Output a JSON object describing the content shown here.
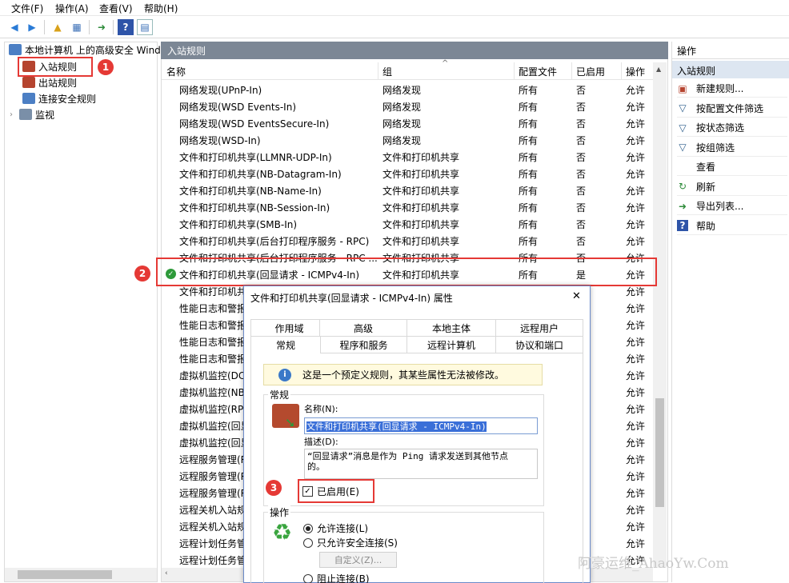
{
  "menu": [
    "文件(F)",
    "操作(A)",
    "查看(V)",
    "帮助(H)"
  ],
  "tree": {
    "root": "本地计算机 上的高级安全 Windows",
    "items": [
      "入站规则",
      "出站规则",
      "连接安全规则",
      "监视"
    ]
  },
  "panel_title": "入站规则",
  "columns": [
    "名称",
    "组",
    "配置文件",
    "已启用",
    "操作"
  ],
  "rows": [
    [
      "网络发现(UPnP-In)",
      "网络发现",
      "所有",
      "否",
      "允许"
    ],
    [
      "网络发现(WSD Events-In)",
      "网络发现",
      "所有",
      "否",
      "允许"
    ],
    [
      "网络发现(WSD EventsSecure-In)",
      "网络发现",
      "所有",
      "否",
      "允许"
    ],
    [
      "网络发现(WSD-In)",
      "网络发现",
      "所有",
      "否",
      "允许"
    ],
    [
      "文件和打印机共享(LLMNR-UDP-In)",
      "文件和打印机共享",
      "所有",
      "否",
      "允许"
    ],
    [
      "文件和打印机共享(NB-Datagram-In)",
      "文件和打印机共享",
      "所有",
      "否",
      "允许"
    ],
    [
      "文件和打印机共享(NB-Name-In)",
      "文件和打印机共享",
      "所有",
      "否",
      "允许"
    ],
    [
      "文件和打印机共享(NB-Session-In)",
      "文件和打印机共享",
      "所有",
      "否",
      "允许"
    ],
    [
      "文件和打印机共享(SMB-In)",
      "文件和打印机共享",
      "所有",
      "否",
      "允许"
    ],
    [
      "文件和打印机共享(后台打印程序服务 - RPC)",
      "文件和打印机共享",
      "所有",
      "否",
      "允许"
    ],
    [
      "文件和打印机共享(后台打印程序服务 - RPC ...",
      "文件和打印机共享",
      "所有",
      "否",
      "允许"
    ],
    [
      "文件和打印机共享(回显请求 - ICMPv4-In)",
      "文件和打印机共享",
      "所有",
      "是",
      "允许"
    ],
    [
      "文件和打印机共",
      "",
      "",
      "",
      "允许"
    ],
    [
      "性能日志和警报",
      "",
      "",
      "",
      "允许"
    ],
    [
      "性能日志和警报",
      "",
      "",
      "",
      "允许"
    ],
    [
      "性能日志和警报",
      "",
      "",
      "",
      "允许"
    ],
    [
      "性能日志和警报",
      "",
      "",
      "",
      "允许"
    ],
    [
      "虚拟机监控(DC",
      "",
      "",
      "",
      "允许"
    ],
    [
      "虚拟机监控(NB",
      "",
      "",
      "",
      "允许"
    ],
    [
      "虚拟机监控(RP",
      "",
      "",
      "",
      "允许"
    ],
    [
      "虚拟机监控(回显",
      "",
      "",
      "",
      "允许"
    ],
    [
      "虚拟机监控(回显",
      "",
      "",
      "",
      "允许"
    ],
    [
      "远程服务管理(R",
      "",
      "",
      "",
      "允许"
    ],
    [
      "远程服务管理(R",
      "",
      "",
      "",
      "允许"
    ],
    [
      "远程服务管理(R",
      "",
      "",
      "",
      "允许"
    ],
    [
      "远程关机入站规",
      "",
      "",
      "",
      "允许"
    ],
    [
      "远程关机入站规",
      "",
      "",
      "",
      "允许"
    ],
    [
      "远程计划任务管",
      "",
      "",
      "",
      "允许"
    ],
    [
      "远程计划任务管",
      "",
      "",
      "",
      "允许"
    ]
  ],
  "actions": {
    "title": "操作",
    "section": "入站规则",
    "items": [
      "新建规则...",
      "按配置文件筛选",
      "按状态筛选",
      "按组筛选",
      "查看",
      "刷新",
      "导出列表...",
      "帮助"
    ]
  },
  "badges": [
    "1",
    "2",
    "3"
  ],
  "dialog": {
    "title": "文件和打印机共享(回显请求 - ICMPv4-In) 属性",
    "close": "✕",
    "tabs_row1": [
      "作用域",
      "高级",
      "本地主体",
      "远程用户"
    ],
    "tabs_row2": [
      "常规",
      "程序和服务",
      "远程计算机",
      "协议和端口"
    ],
    "info": "这是一个预定义规则，其某些属性无法被修改。",
    "general_label": "常规",
    "name_label": "名称(N):",
    "name_value": "文件和打印机共享(回显请求 - ICMPv4-In)",
    "desc_label": "描述(D):",
    "desc_value": "“回显请求”消息是作为 Ping 请求发送到其他节点的。",
    "enabled_label": "已启用(E)",
    "action_label": "操作",
    "radio_allow": "允许连接(L)",
    "radio_secure": "只允许安全连接(S)",
    "customize": "自定义(Z)...",
    "radio_block": "阻止连接(B)"
  },
  "watermark": "阿豪运维_AhaoYw.Com",
  "colors": {
    "accent": "#7c8795",
    "highlight_red": "#e53935",
    "selection": "#cce8ff"
  }
}
